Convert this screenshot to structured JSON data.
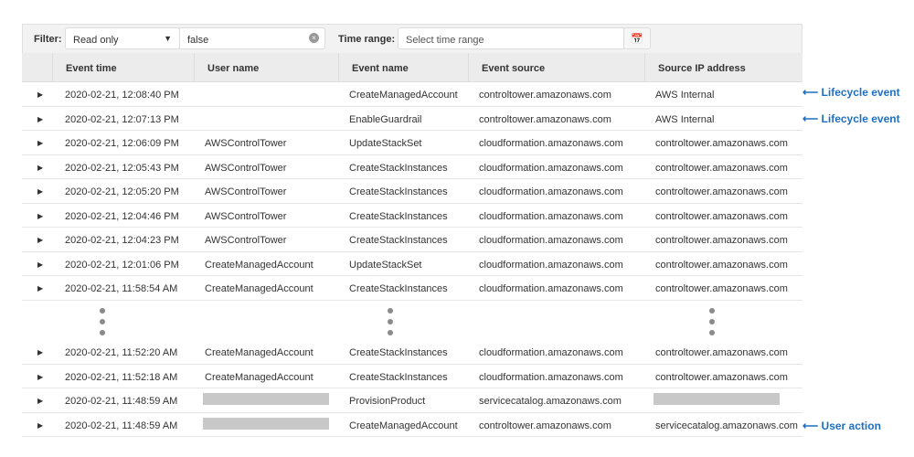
{
  "filter": {
    "label": "Filter:",
    "select_value": "Read only",
    "text_value": "false",
    "time_label": "Time range:",
    "time_placeholder": "Select time range"
  },
  "columns": [
    "Event time",
    "User name",
    "Event name",
    "Event source",
    "Source IP address"
  ],
  "rows_top": [
    [
      "2020-02-21, 12:08:40 PM",
      "",
      "CreateManagedAccount",
      "controltower.amazonaws.com",
      "AWS Internal"
    ],
    [
      "2020-02-21, 12:07:13 PM",
      "",
      "EnableGuardrail",
      "controltower.amazonaws.com",
      "AWS Internal"
    ],
    [
      "2020-02-21, 12:06:09 PM",
      "AWSControlTower",
      "UpdateStackSet",
      "cloudformation.amazonaws.com",
      "controltower.amazonaws.com"
    ],
    [
      "2020-02-21, 12:05:43 PM",
      "AWSControlTower",
      "CreateStackInstances",
      "cloudformation.amazonaws.com",
      "controltower.amazonaws.com"
    ],
    [
      "2020-02-21, 12:05:20 PM",
      "AWSControlTower",
      "CreateStackInstances",
      "cloudformation.amazonaws.com",
      "controltower.amazonaws.com"
    ],
    [
      "2020-02-21, 12:04:46 PM",
      "AWSControlTower",
      "CreateStackInstances",
      "cloudformation.amazonaws.com",
      "controltower.amazonaws.com"
    ],
    [
      "2020-02-21, 12:04:23 PM",
      "AWSControlTower",
      "CreateStackInstances",
      "cloudformation.amazonaws.com",
      "controltower.amazonaws.com"
    ],
    [
      "2020-02-21, 12:01:06 PM",
      "CreateManagedAccount",
      "UpdateStackSet",
      "cloudformation.amazonaws.com",
      "controltower.amazonaws.com"
    ],
    [
      "2020-02-21, 11:58:54 AM",
      "CreateManagedAccount",
      "CreateStackInstances",
      "cloudformation.amazonaws.com",
      "controltower.amazonaws.com"
    ]
  ],
  "rows_bottom": [
    [
      "2020-02-21, 11:52:20 AM",
      "CreateManagedAccount",
      "CreateStackInstances",
      "cloudformation.amazonaws.com",
      "controltower.amazonaws.com"
    ],
    [
      "2020-02-21, 11:52:18 AM",
      "CreateManagedAccount",
      "CreateStackInstances",
      "cloudformation.amazonaws.com",
      "controltower.amazonaws.com"
    ],
    [
      "2020-02-21, 11:48:59 AM",
      "[redacted]",
      "ProvisionProduct",
      "servicecatalog.amazonaws.com",
      "[redacted]"
    ],
    [
      "2020-02-21, 11:48:59 AM",
      "[redacted]",
      "CreateManagedAccount",
      "controltower.amazonaws.com",
      "servicecatalog.amazonaws.com"
    ]
  ],
  "annotations": {
    "lifecycle": "⟵ Lifecycle event",
    "user_action": "⟵ User action"
  }
}
